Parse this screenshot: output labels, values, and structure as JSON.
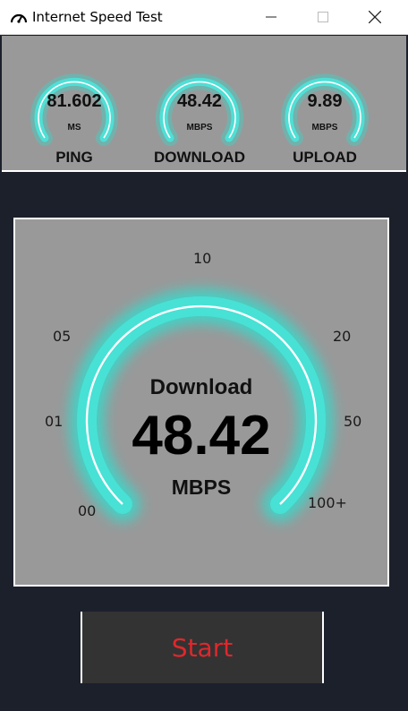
{
  "window": {
    "title": "Internet Speed Test",
    "icon": "speedometer-icon",
    "controls": [
      "minimize-icon",
      "maximize-icon",
      "close-icon"
    ]
  },
  "metrics": [
    {
      "value": "81.602",
      "unit": "MS",
      "label": "PING",
      "level": 0.6
    },
    {
      "value": "48.42",
      "unit": "MBPS",
      "label": "DOWNLOAD",
      "level": 0.6
    },
    {
      "value": "9.89",
      "unit": "MBPS",
      "label": "UPLOAD",
      "level": 0.6
    }
  ],
  "gauge": {
    "title": "Download",
    "value": "48.42",
    "unit": "MBPS",
    "ticks": [
      "00",
      "01",
      "05",
      "10",
      "20",
      "50",
      "100+"
    ],
    "level": 0.7
  },
  "start_button": {
    "label": "Start"
  },
  "colors": {
    "accent_glow": "#2de0d0",
    "start_text": "#e0272c",
    "panel": "#999999",
    "background": "#1b202b"
  }
}
